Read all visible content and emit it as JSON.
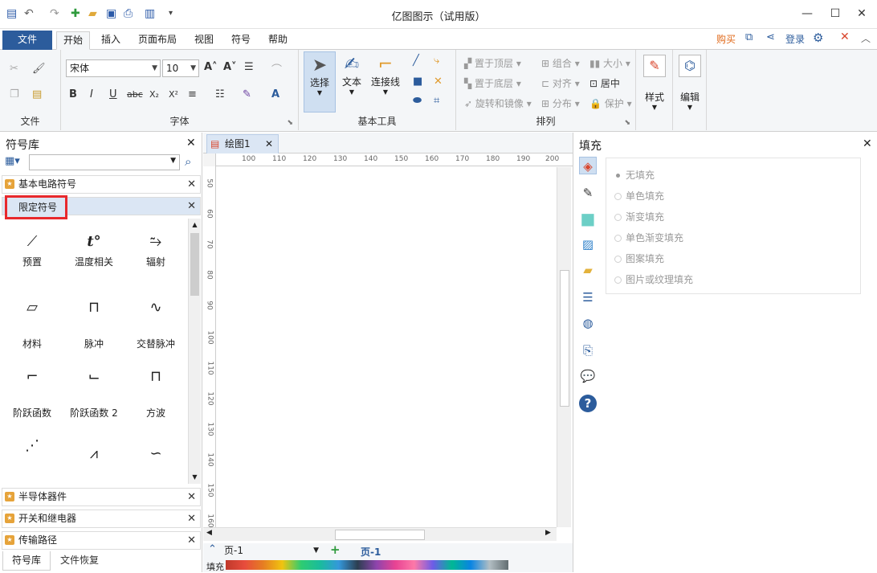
{
  "window": {
    "title": "亿图图示（试用版）",
    "minimize": "—",
    "maximize": "☐",
    "close": "✕"
  },
  "quick_access": {
    "undo": "↶",
    "redo": "↷",
    "dropdown": "▾"
  },
  "menu": {
    "file": "文件",
    "tabs": [
      "开始",
      "插入",
      "页面布局",
      "视图",
      "符号",
      "帮助"
    ],
    "buy": "购买",
    "login": "登录"
  },
  "ribbon": {
    "groups": {
      "file": "文件",
      "font": "字体",
      "basic_tools": "基本工具",
      "arrange": "排列",
      "style": "样式",
      "edit": "编辑"
    },
    "font_name": "宋体",
    "font_size": "10",
    "format_buttons": [
      "B",
      "I",
      "U",
      "abc",
      "X₂",
      "X²"
    ],
    "tools": {
      "select": "选择",
      "text": "文本",
      "connector": "连接线"
    },
    "arrange_items": [
      "置于顶层",
      "组合",
      "大小",
      "置于底层",
      "对齐",
      "居中",
      "旋转和镜像",
      "分布",
      "保护"
    ]
  },
  "left_panel": {
    "title": "符号库",
    "search_placeholder": "",
    "categories_top": [
      "基本电路符号",
      "限定符号"
    ],
    "symbols": [
      {
        "label": "预置",
        "glyph": "⟋"
      },
      {
        "label": "温度相关",
        "glyph": "t°"
      },
      {
        "label": "辐射",
        "glyph": "⥲"
      },
      {
        "label": "材料",
        "glyph": "▱"
      },
      {
        "label": "脉冲",
        "glyph": "⊓"
      },
      {
        "label": "交替脉冲",
        "glyph": "∿"
      },
      {
        "label": "阶跃函数",
        "glyph": "⌐"
      },
      {
        "label": "阶跃函数 2",
        "glyph": "⌙"
      },
      {
        "label": "方波",
        "glyph": "⊓"
      },
      {
        "label": "",
        "glyph": "⋰"
      },
      {
        "label": "",
        "glyph": "⩘"
      },
      {
        "label": "",
        "glyph": "∽"
      }
    ],
    "categories_bottom": [
      "半导体器件",
      "开关和继电器",
      "传输路径"
    ],
    "bottom_tabs": [
      "符号库",
      "文件恢复"
    ]
  },
  "canvas": {
    "tab_name": "绘图1",
    "h_ruler": [
      "100",
      "110",
      "120",
      "130",
      "140",
      "150",
      "160",
      "170",
      "180",
      "190",
      "200"
    ],
    "v_ruler": [
      "50",
      "60",
      "70",
      "80",
      "90",
      "100",
      "110",
      "120",
      "130",
      "140",
      "150",
      "160"
    ]
  },
  "status": {
    "page_select": "页-1",
    "page_tab": "页-1",
    "fill_label": "填充"
  },
  "right_panel": {
    "title": "填充",
    "options": [
      "无填充",
      "单色填充",
      "渐变填充",
      "单色渐变填充",
      "图案填充",
      "图片或纹理填充"
    ]
  },
  "colors": {
    "accent": "#2c5c9c",
    "highlight_border": "#e8292d",
    "selected_category_bg": "#dbe6f4"
  }
}
